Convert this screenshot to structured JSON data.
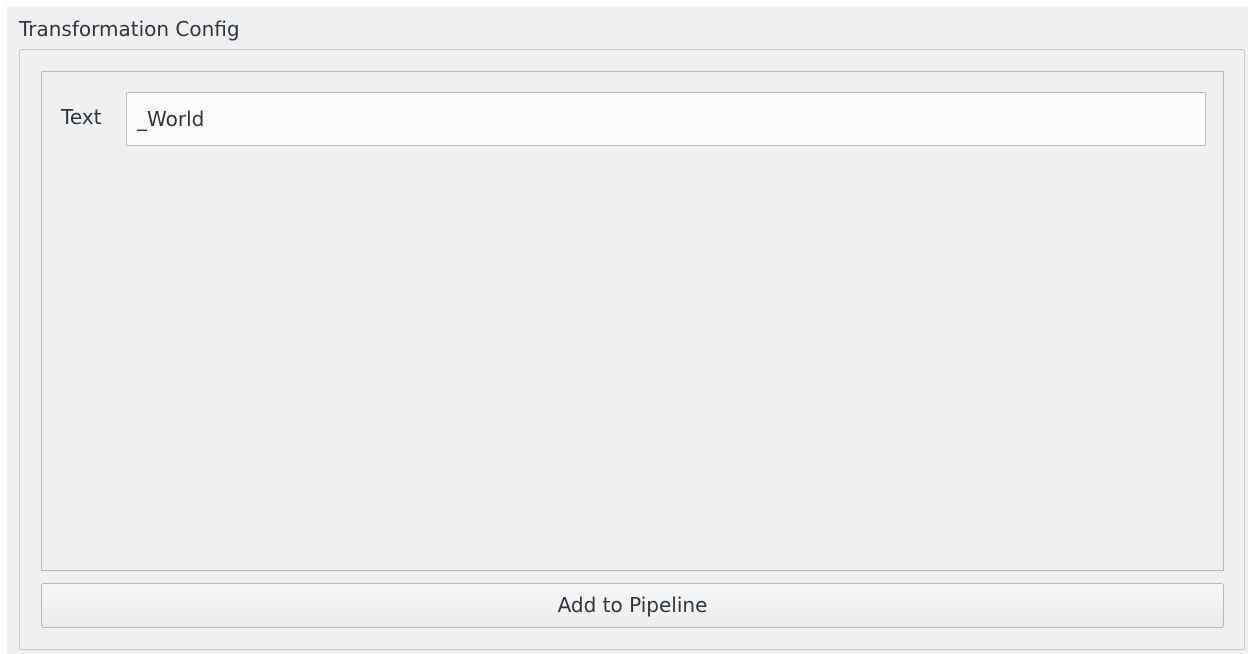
{
  "group": {
    "title": "Transformation Config"
  },
  "config": {
    "text_label": "Text",
    "text_value": "_World"
  },
  "actions": {
    "add_label": "Add to Pipeline"
  }
}
